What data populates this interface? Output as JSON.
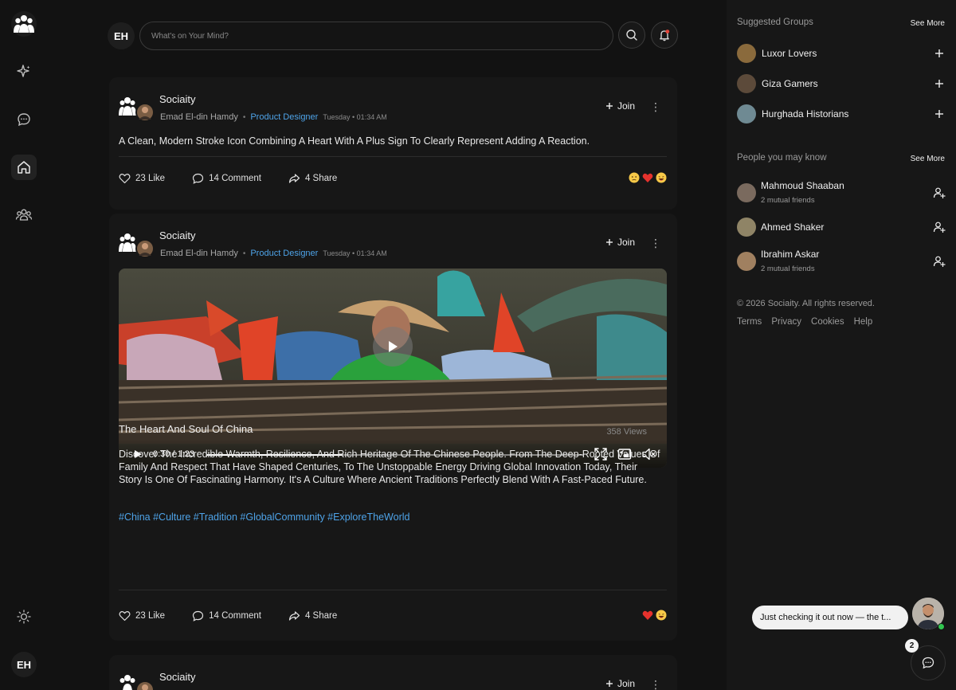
{
  "app": {
    "logo": "people-group-logo"
  },
  "rail": {
    "items": [
      {
        "icon": "sparkle-icon"
      },
      {
        "icon": "chat-bubble-icon"
      },
      {
        "icon": "home-icon",
        "active": true
      },
      {
        "icon": "groups-icon"
      }
    ],
    "theme_icon": "sun-icon",
    "user_initials": "EH"
  },
  "topbar": {
    "user_initials": "EH",
    "search_placeholder": "What's on Your Mind?",
    "search_icon": "search-icon",
    "notification_icon": "bell-icon"
  },
  "posts": [
    {
      "group": "Sociaity",
      "author": "Emad El-din Hamdy",
      "role": "Product Designer",
      "time": "Tuesday • 01:34 AM",
      "join_label": "Join",
      "text": "A Clean, Modern Stroke Icon Combining A Heart With A Plus Sign To Clearly Represent Adding A Reaction.",
      "likes": "23 Like",
      "comments": "14 Comment",
      "shares": "4 Share",
      "reactions": [
        "sad",
        "heart",
        "laugh"
      ]
    },
    {
      "group": "Sociaity",
      "author": "Emad El-din Hamdy",
      "role": "Product Designer",
      "time": "Tuesday • 01:34 AM",
      "join_label": "Join",
      "video": {
        "time": "0:30 / 1:23",
        "progress": 0.36
      },
      "video_title": "The Heart And Soul Of China",
      "views": "358 Views",
      "description": "Discover The Incredible Warmth, Resilience, And Rich Heritage Of The Chinese People. From The Deep-Rooted Values Of Family And Respect That Have Shaped Centuries, To The Unstoppable Energy Driving Global Innovation Today, Their Story Is One Of Fascinating Harmony. It's A Culture Where Ancient Traditions Perfectly Blend With A Fast-Paced Future.",
      "tags": "#China #Culture #Tradition #GlobalCommunity #ExploreTheWorld",
      "likes": "23 Like",
      "comments": "14 Comment",
      "shares": "4 Share",
      "reactions": [
        "heart",
        "laugh"
      ]
    },
    {
      "group": "Sociaity",
      "join_label": "Join"
    }
  ],
  "sidebar": {
    "groups_title": "Suggested Groups",
    "groups_see_more": "See More",
    "groups": [
      {
        "name": "Luxor Lovers",
        "color": "#8a6a3c"
      },
      {
        "name": "Giza Gamers",
        "color": "#5c4a3a"
      },
      {
        "name": "Hurghada Historians",
        "color": "#6f8a93"
      }
    ],
    "people_title": "People you may know",
    "people_see_more": "See More",
    "people": [
      {
        "name": "Mahmoud Shaaban",
        "sub": "2 mutual friends",
        "color": "#7a6a5e"
      },
      {
        "name": "Ahmed Shaker",
        "sub": "",
        "color": "#8f8466"
      },
      {
        "name": "Ibrahim Askar",
        "sub": "2 mutual friends",
        "color": "#a08060"
      }
    ],
    "copyright": "© 2026 Sociaity. All rights reserved.",
    "links": [
      "Terms",
      "Privacy",
      "Cookies",
      "Help"
    ]
  },
  "chat": {
    "preview": "Just checking it out now — the t...",
    "badge": "2"
  }
}
